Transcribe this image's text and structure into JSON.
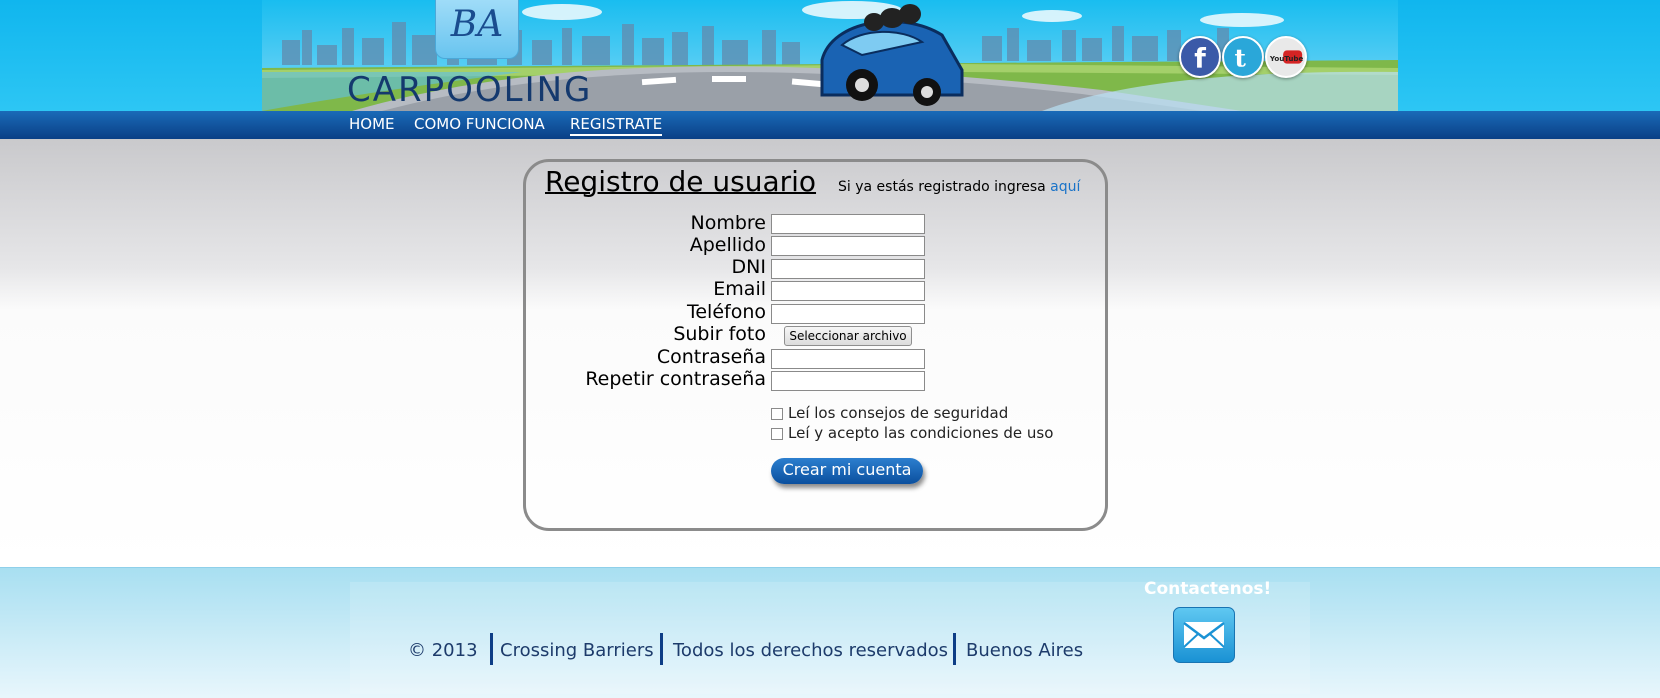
{
  "brand": {
    "badge": "BA",
    "name": "CARPOOLING"
  },
  "social": [
    {
      "icon": "facebook-icon"
    },
    {
      "icon": "twitter-icon"
    },
    {
      "icon": "youtube-icon",
      "text": "YouTube"
    }
  ],
  "nav": {
    "items": [
      "HOME",
      "COMO FUNCIONA",
      "REGISTRATE"
    ],
    "active": "REGISTRATE"
  },
  "form": {
    "title": "Registro de usuario",
    "note": "Si ya estás registrado ingresa",
    "note_link": "aquí",
    "fields": [
      {
        "label": "Nombre",
        "value": ""
      },
      {
        "label": "Apellido",
        "value": ""
      },
      {
        "label": "DNI",
        "value": ""
      },
      {
        "label": "Email",
        "value": ""
      },
      {
        "label": "Teléfono",
        "value": ""
      },
      {
        "label": "Subir foto",
        "button": "Seleccionar archivo"
      },
      {
        "label": "Contraseña",
        "value": ""
      },
      {
        "label": "Repetir contraseña",
        "value": ""
      }
    ],
    "checkboxes": [
      {
        "label": "Leí los consejos de seguridad",
        "checked": false
      },
      {
        "label": "Leí y acepto las condiciones de uso",
        "checked": false
      }
    ],
    "submit": "Crear mi cuenta"
  },
  "footer": {
    "copyright": "© 2013",
    "company": "Crossing Barriers",
    "rights": "Todos los derechos reservados",
    "city": "Buenos Aires",
    "contact": "Contactenos!"
  },
  "colors": {
    "accent": "#1a73c8",
    "nav": "#0a3f86",
    "header": "#10b6ee"
  }
}
